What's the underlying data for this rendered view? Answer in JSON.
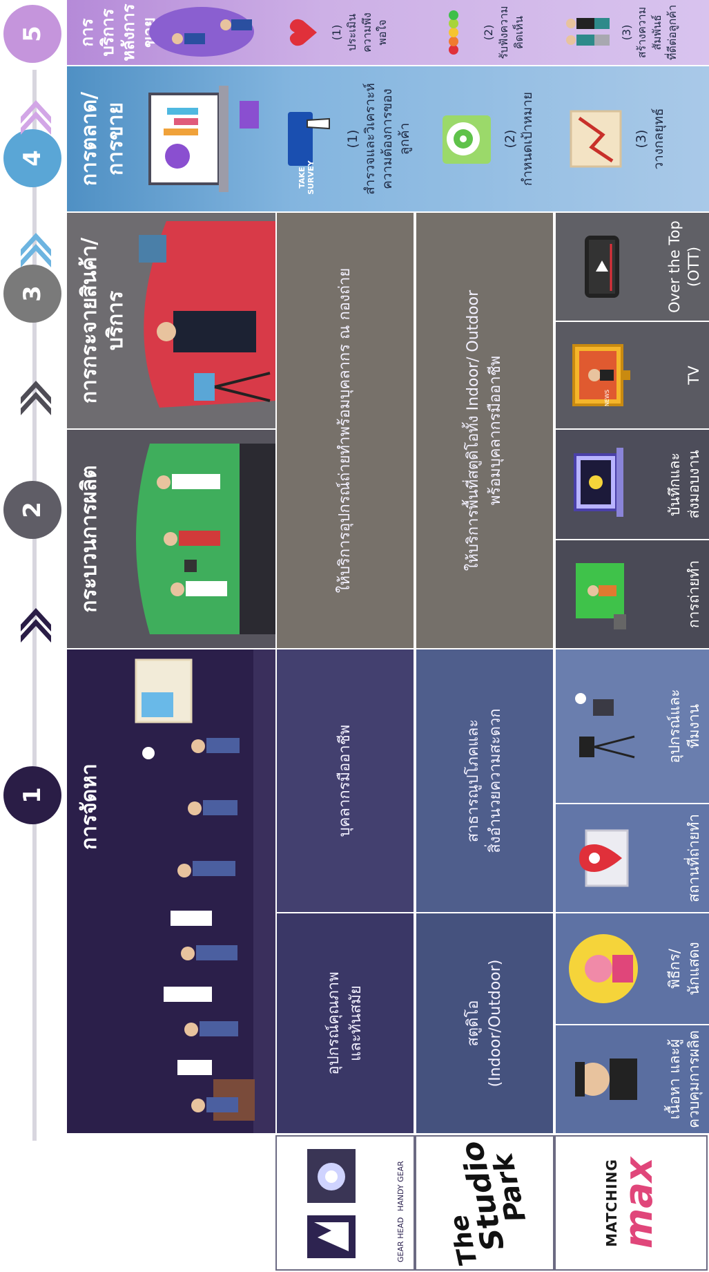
{
  "steps": [
    {
      "number": "1",
      "color": "#2a1d46"
    },
    {
      "number": "2",
      "color": "#5f5d66"
    },
    {
      "number": "3",
      "color": "#7a7a7a"
    },
    {
      "number": "4",
      "color": "#5aa6d6"
    },
    {
      "number": "5",
      "color": "#c595dc"
    }
  ],
  "columns": {
    "sourcing": {
      "title": "การจัดหา",
      "color": "#2b1f4a"
    },
    "production": {
      "title": "กระบวนการผลิต",
      "color": "#57555e"
    },
    "distribution": {
      "title_line1": "การกระจายสินค้า/",
      "title_line2": "บริการ",
      "color": "#6e6c70"
    },
    "marketing": {
      "title_line1": "การตลาด/",
      "title_line2": "การขาย",
      "color": "#4f90c4",
      "items": [
        {
          "number": "(1)",
          "line1": "สำรวจและวิเคราะห์",
          "line2": "ความต้องการของ",
          "line3": "ลูกค้า"
        },
        {
          "number": "(2)",
          "line1": "กำหนดเป้าหมาย"
        },
        {
          "number": "(3)",
          "line1": "วางกลยุทธ์"
        }
      ],
      "survey_label": "TAKE SURVEY"
    },
    "aftersales": {
      "title_line1": "การบริการ",
      "title_line2": "หลังการขาย",
      "color": "#b58ad8",
      "items": [
        {
          "number": "(1)",
          "line1": "ประเมิน",
          "line2": "ความพึงพอใจ"
        },
        {
          "number": "(2)",
          "line1": "รับฟังความคิดเห็น"
        },
        {
          "number": "(3)",
          "line1": "สร้างความสัมพันธ์",
          "line2": "ที่ดีต่อลูกค้า"
        }
      ]
    }
  },
  "rows": {
    "handygear": {
      "logo_text": "HANDY GEAR",
      "logo_text2": "GEAR HEAD",
      "equipment": {
        "line1": "อุปกรณ์คุณภาพ",
        "line2": "และทันสมัย"
      },
      "personnel": "บุคลากรมืออาชีพ",
      "production_service": "ให้บริการอุปกรณ์ถ่ายทำพร้อมบุคลากร ณ กองถ่าย"
    },
    "studiopark": {
      "logo_line1": "The",
      "logo_line2": "Studio",
      "logo_line3": "Park",
      "studio": {
        "line1": "สตูดิโอ",
        "line2": "(Indoor/Outdoor)"
      },
      "utilities": {
        "line1": "สาธารณูปโภคและ",
        "line2": "สิ่งอำนวยความสะดวก"
      },
      "production_service": {
        "line1": "ให้บริการพื้นที่สตูดิโอทั้ง Indoor/ Outdoor",
        "line2": "พร้อมบุคลากรมืออาชีพ"
      }
    },
    "matchingmax": {
      "logo_line1": "MATCHING",
      "logo_line2": "max",
      "sourcing_items": [
        {
          "line1": "เนื้อหา และผู้",
          "line2": "ควบคุมการผลิต",
          "icon": "director-icon"
        },
        {
          "line1": "พิธีกร/",
          "line2": "นักแสดง",
          "icon": "host-icon"
        },
        {
          "line1": "สถานที่ถ่ายทำ",
          "line2": "",
          "icon": "map-pin-icon"
        },
        {
          "line1": "อุปกรณ์และ",
          "line2": "ทีมงาน",
          "icon": "camera-crew-icon"
        }
      ],
      "production_items": [
        {
          "line1": "การถ่ายทำ",
          "line2": "",
          "icon": "green-screen-icon"
        },
        {
          "line1": "บันทึกและ",
          "line2": "ส่งมอบงาน",
          "icon": "laptop-upload-icon"
        }
      ],
      "distribution_items": [
        {
          "line1": "TV",
          "line2": "",
          "icon": "tv-icon"
        },
        {
          "line1": "Over the Top",
          "line2": "(OTT)",
          "icon": "phone-play-icon"
        }
      ],
      "tv_label": "NEWS"
    }
  }
}
